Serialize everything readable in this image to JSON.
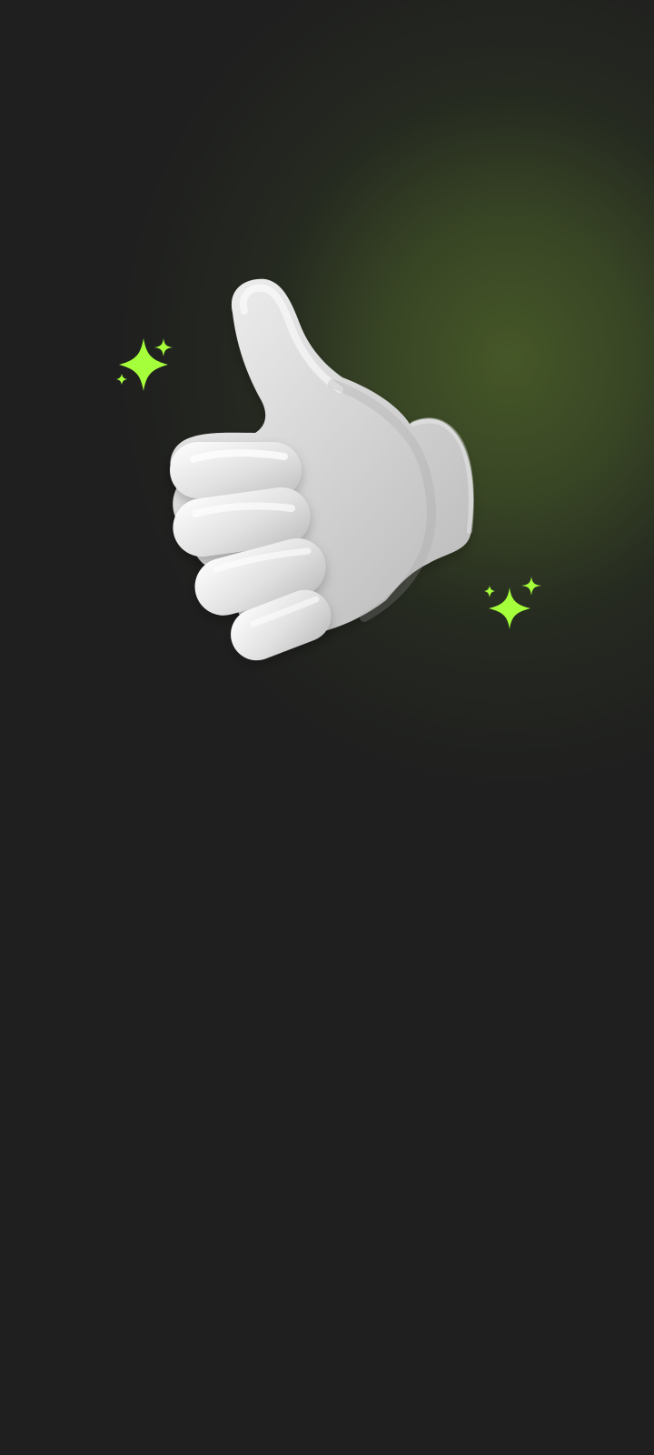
{
  "screen": {
    "background": "#1f1f1f",
    "glow_color": "#485a28"
  },
  "illustration": {
    "icon": "thumbs-up-icon",
    "hand_color": "#d9d9d9",
    "sparkle_color": "#a6ff3b"
  }
}
